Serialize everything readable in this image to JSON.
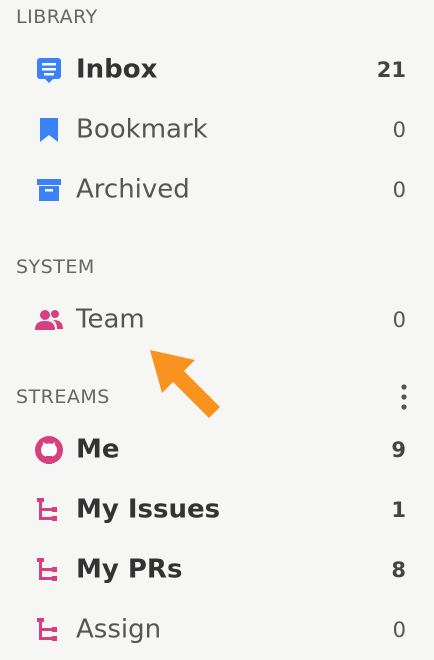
{
  "sections": {
    "library": {
      "title": "LIBRARY"
    },
    "system": {
      "title": "SYSTEM"
    },
    "streams": {
      "title": "STREAMS"
    }
  },
  "items": {
    "inbox": {
      "label": "Inbox",
      "count": "21",
      "icon": "inbox-icon"
    },
    "bookmark": {
      "label": "Bookmark",
      "count": "0",
      "icon": "bookmark-icon"
    },
    "archived": {
      "label": "Archived",
      "count": "0",
      "icon": "archive-box-icon"
    },
    "team": {
      "label": "Team",
      "count": "0",
      "icon": "people-icon"
    },
    "me": {
      "label": "Me",
      "count": "9",
      "icon": "github-icon"
    },
    "my_issues": {
      "label": "My Issues",
      "count": "1",
      "icon": "hierarchy-icon"
    },
    "my_prs": {
      "label": "My PRs",
      "count": "8",
      "icon": "hierarchy-icon"
    },
    "assign": {
      "label": "Assign",
      "count": "0",
      "icon": "hierarchy-icon"
    }
  },
  "colors": {
    "library_icon": "#3b82f6",
    "stream_icon": "#d6407e",
    "annotation_arrow": "#f7931e"
  }
}
